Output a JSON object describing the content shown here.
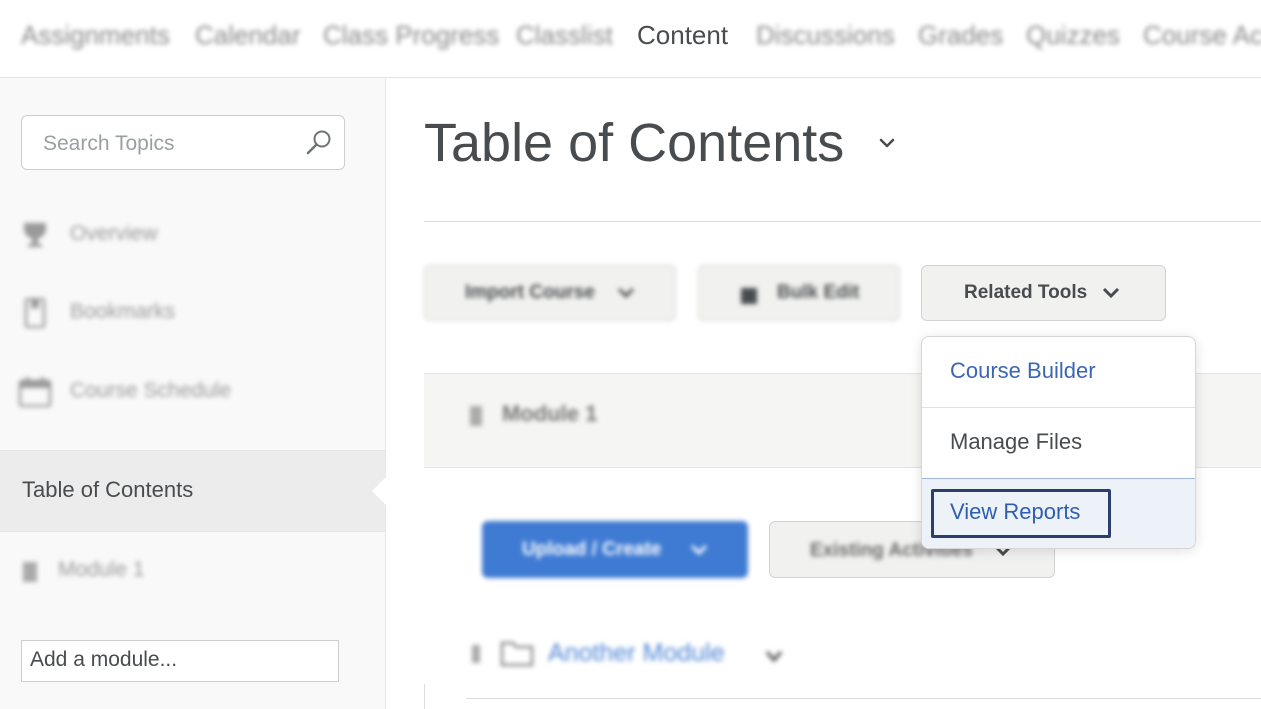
{
  "top_nav": {
    "items": [
      "Assignments",
      "Calendar",
      "Class Progress",
      "Classlist",
      "Content",
      "Discussions",
      "Grades",
      "Quizzes",
      "Course Ac"
    ],
    "active": "Content"
  },
  "sidebar": {
    "search": {
      "placeholder": "Search Topics",
      "icon": "search-icon"
    },
    "items": [
      {
        "label": "Overview",
        "icon": "trophy-icon"
      },
      {
        "label": "Bookmarks",
        "icon": "bookmark-icon"
      },
      {
        "label": "Course Schedule",
        "icon": "calendar-icon"
      }
    ],
    "selected_label": "Table of Contents",
    "module_label": "Module 1",
    "add_module_placeholder": "Add a module..."
  },
  "main": {
    "title": "Table of Contents",
    "toolbar": {
      "import_label": "Import Course",
      "bulk_label": "Bulk Edit",
      "related_label": "Related Tools"
    },
    "module_card_label": "Module 1",
    "upload_label": "Upload / Create",
    "existing_label": "Existing Activities",
    "another_module_label": "Another Module"
  },
  "related_tools_menu": {
    "items": [
      "Course Builder",
      "Manage Files",
      "View Reports"
    ],
    "highlighted": "View Reports"
  },
  "colors": {
    "accent_blue": "#3f7bd3",
    "link_blue": "#3a66b5",
    "text": "#494c4e",
    "focus_border": "#2c3e6b"
  }
}
